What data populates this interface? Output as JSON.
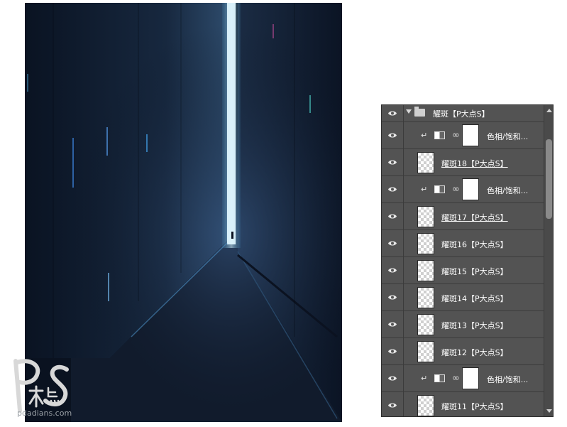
{
  "canvas": {
    "background": "#0a1220",
    "accent_glow": "#9fe6ff"
  },
  "watermark": {
    "site": "pdadians.com"
  },
  "layers_panel": {
    "group": {
      "label": "耀斑【P大点S】"
    },
    "layers": [
      {
        "type": "adjustment",
        "label": "色相/饱和...",
        "icon": "hue-saturation-icon"
      },
      {
        "type": "pixel",
        "label": "耀斑18【P大点S】",
        "underlined": true
      },
      {
        "type": "adjustment",
        "label": "色相/饱和...",
        "icon": "hue-saturation-icon"
      },
      {
        "type": "pixel",
        "label": "耀斑17【P大点S】",
        "underlined": true
      },
      {
        "type": "pixel",
        "label": "耀斑16【P大点S】"
      },
      {
        "type": "pixel",
        "label": "耀斑15【P大点S】"
      },
      {
        "type": "pixel",
        "label": "耀斑14【P大点S】"
      },
      {
        "type": "pixel",
        "label": "耀斑13【P大点S】"
      },
      {
        "type": "pixel",
        "label": "耀斑12【P大点S】"
      },
      {
        "type": "adjustment",
        "label": "色相/饱和...",
        "icon": "hue-saturation-icon"
      },
      {
        "type": "pixel",
        "label": "耀斑11【P大点S】"
      }
    ]
  }
}
